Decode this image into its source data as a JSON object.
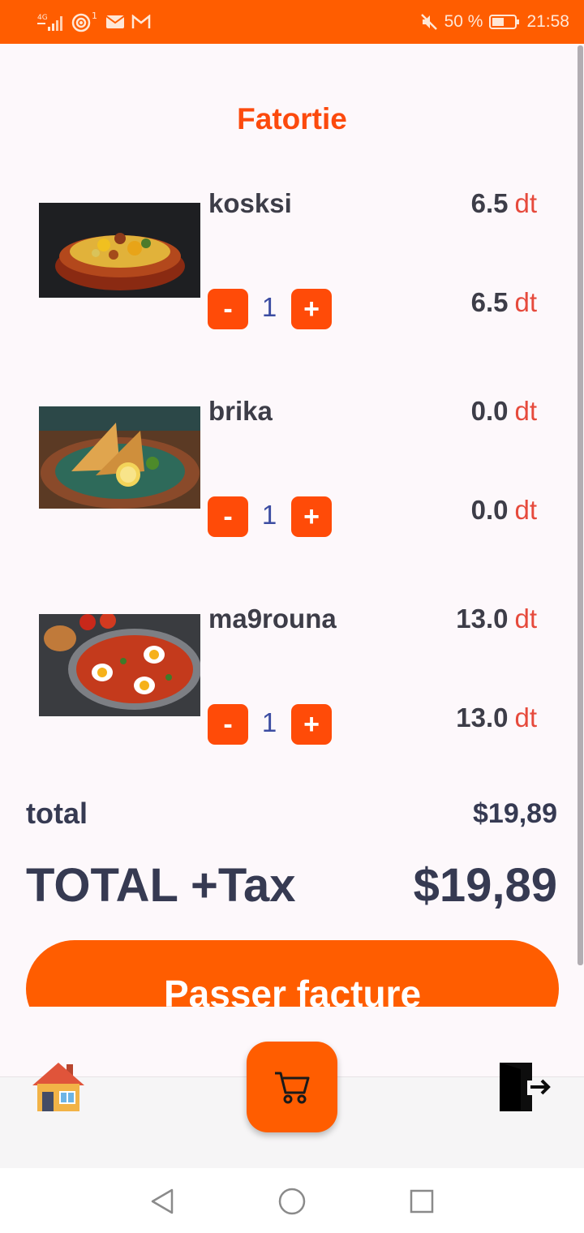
{
  "status_bar": {
    "network": "4G",
    "notification_count": "1",
    "battery": "50 %",
    "time": "21:58"
  },
  "page_title": "Fatortie",
  "currency": "dt",
  "items": [
    {
      "name": "kosksi",
      "unit_price": "6.5",
      "quantity": "1",
      "line_price": "6.5",
      "image_icon": "couscous-dish-image"
    },
    {
      "name": "brika",
      "unit_price": "0.0",
      "quantity": "1",
      "line_price": "0.0",
      "image_icon": "brik-pastry-image"
    },
    {
      "name": "ma9rouna",
      "unit_price": "13.0",
      "quantity": "1",
      "line_price": "13.0",
      "image_icon": "shakshuka-pan-image"
    }
  ],
  "controls": {
    "minus_label": "-",
    "plus_label": "+"
  },
  "summary": {
    "total_label": "total",
    "total_value": "$19,89",
    "total_tax_label": "TOTAL +Tax",
    "total_tax_value": "$19,89"
  },
  "checkout_label": "Passer facture",
  "bottom_nav": {
    "home_icon": "house-icon",
    "cart_icon": "shopping-cart-icon",
    "logout_icon": "logout-door-icon"
  },
  "colors": {
    "accent": "#ff5d00",
    "button": "#ff4b08",
    "title": "#fc4a0d",
    "text_dark": "#363a52",
    "currency": "#e64a3c",
    "quantity": "#3c4da2"
  }
}
